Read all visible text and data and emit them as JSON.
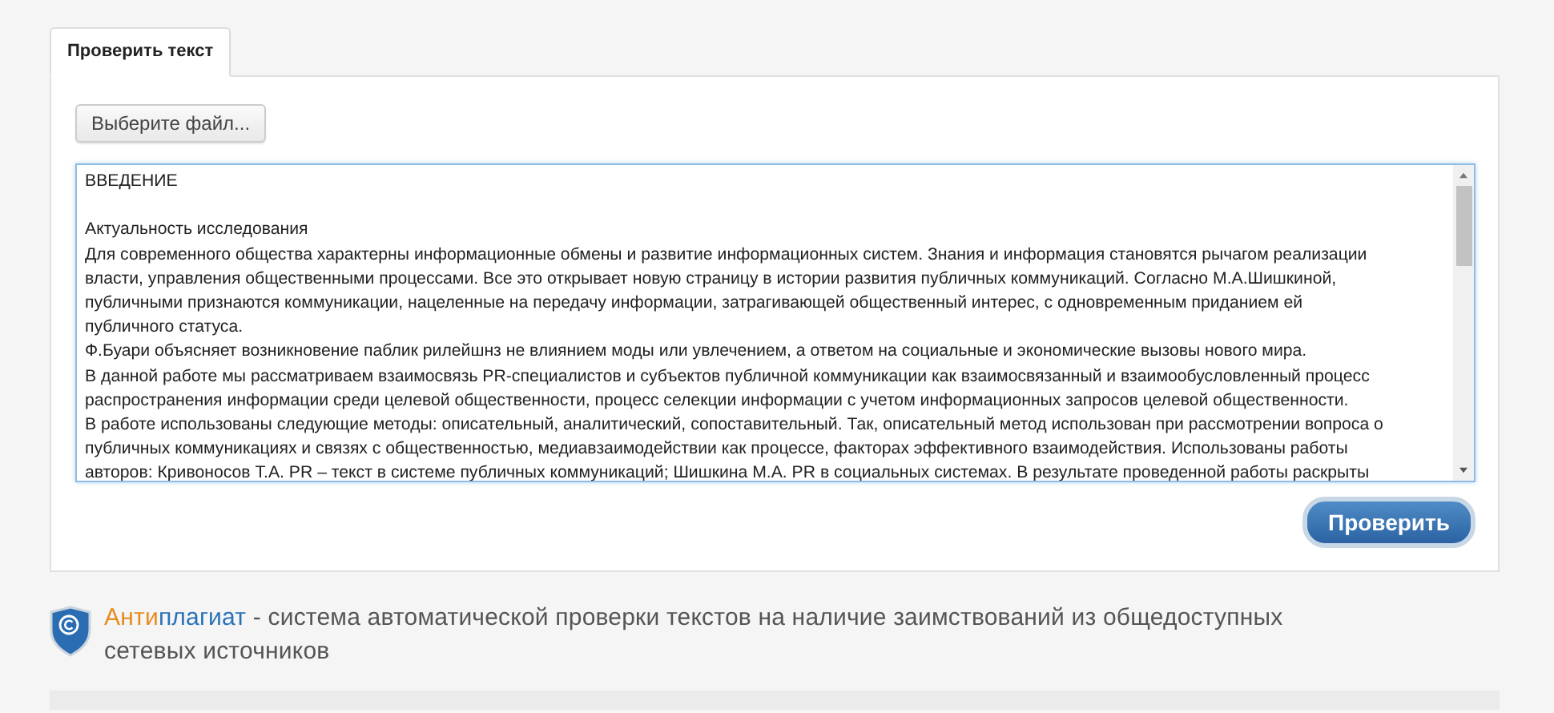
{
  "tabs": [
    {
      "label": "Проверить текст",
      "selected": true
    }
  ],
  "file_button": {
    "label": "Выберите файл..."
  },
  "text_area": {
    "heading": "ВВЕДЕНИЕ",
    "lines": [
      "Актуальность исследования",
      "Для современного общества характерны информационные обмены и развитие информационных систем. Знания и информация становятся рычагом реализации",
      "власти, управления общественными процессами. Все это открывает новую страницу в истории развития публичных коммуникаций. Согласно М.А.Шишкиной,",
      "публичными признаются коммуникации, нацеленные на передачу информации, затрагивающей общественный интерес, с одновременным приданием ей",
      "публичного статуса.",
      "Ф.Буари объясняет возникновение паблик рилейшнз не влиянием моды или увлечением, а ответом на социальные и экономические вызовы нового мира.",
      "В данной работе мы рассматриваем взаимосвязь PR-специалистов и субъектов публичной коммуникации как взаимосвязанный и взаимообусловленный процесс",
      "распространения информации среди целевой общественности, процесс селекции информации с учетом информационных запросов целевой общественности.",
      "В работе использованы следующие методы: описательный, аналитический, сопоставительный. Так, описательный метод использован при рассмотрении вопроса о",
      "публичных коммуникациях и связях с общественностью, медиавзаимодействии как процессе, факторах эффективного взаимодействия. Использованы работы",
      "авторов: Кривоносов Т.А. PR – текст в системе публичных коммуникаций; Шишкина М.А. PR в социальных системах. В результате проведенной работы раскрыты"
    ]
  },
  "submit_button": {
    "label": "Проверить"
  },
  "footer": {
    "brand": [
      {
        "text": "Анти",
        "kind": "accent"
      },
      {
        "text": "плагиат",
        "kind": "primary"
      }
    ],
    "tagline": " - система автоматической проверки текстов на наличие заимствований из общедоступных сетевых источников"
  }
}
